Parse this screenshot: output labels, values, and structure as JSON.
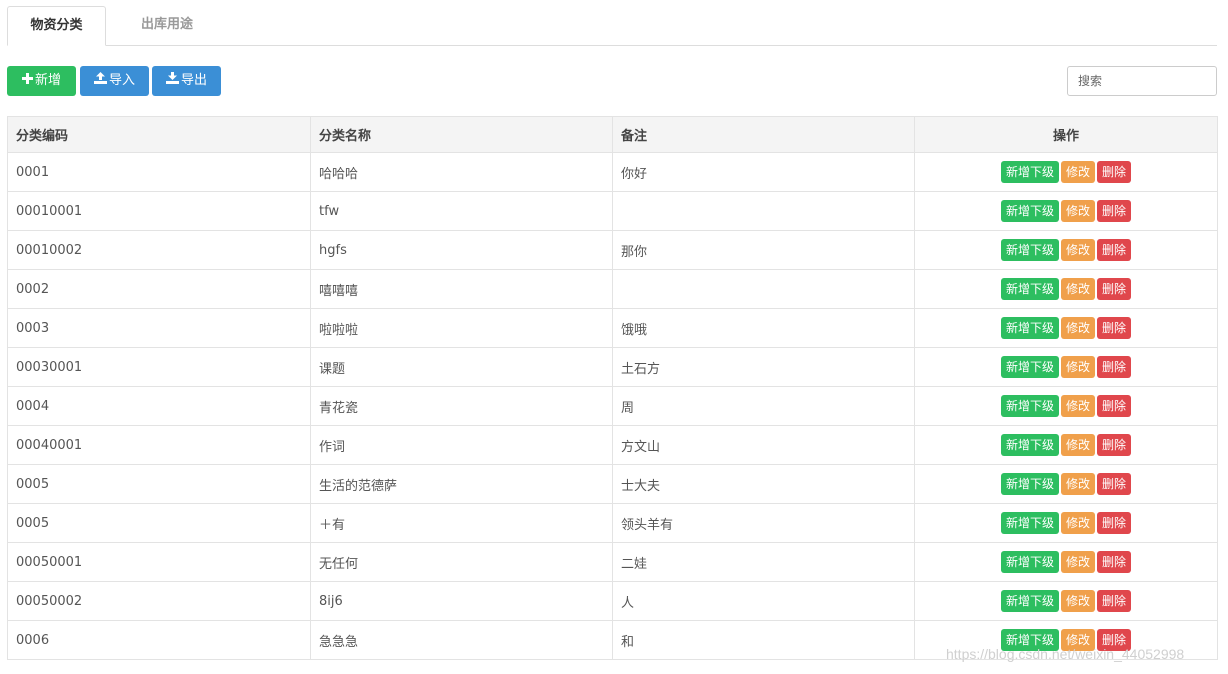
{
  "tabs": [
    {
      "label": "物资分类",
      "active": true
    },
    {
      "label": "出库用途",
      "active": false
    }
  ],
  "toolbar": {
    "add_label": "新增",
    "import_label": "导入",
    "export_label": "导出",
    "add_icon": "plus-icon",
    "import_icon": "upload-icon",
    "export_icon": "download-icon"
  },
  "search": {
    "placeholder": "搜索",
    "value": ""
  },
  "table": {
    "headers": {
      "code": "分类编码",
      "name": "分类名称",
      "remark": "备注",
      "ops": "操作"
    },
    "actions": {
      "add_child": "新增下级",
      "edit": "修改",
      "delete": "删除"
    },
    "rows": [
      {
        "code": "0001",
        "name": "哈哈哈",
        "remark": "你好"
      },
      {
        "code": "00010001",
        "name": "tfw",
        "remark": ""
      },
      {
        "code": "00010002",
        "name": "hgfs",
        "remark": "那你"
      },
      {
        "code": "0002",
        "name": "嘻嘻嘻",
        "remark": ""
      },
      {
        "code": "0003",
        "name": "啦啦啦",
        "remark": "饿哦"
      },
      {
        "code": "00030001",
        "name": "课题",
        "remark": "土石方"
      },
      {
        "code": "0004",
        "name": "青花瓷",
        "remark": "周"
      },
      {
        "code": "00040001",
        "name": "作词",
        "remark": "方文山"
      },
      {
        "code": "0005",
        "name": "生活的范德萨",
        "remark": "士大夫"
      },
      {
        "code": "0005",
        "name": "＋有",
        "remark": "领头羊有"
      },
      {
        "code": "00050001",
        "name": "无任何",
        "remark": "二娃"
      },
      {
        "code": "00050002",
        "name": "8ij6",
        "remark": "人"
      },
      {
        "code": "0006",
        "name": "急急急",
        "remark": "和"
      }
    ]
  },
  "colors": {
    "success": "#2dbe60",
    "primary": "#3b8fd6",
    "warning": "#f0a04b",
    "danger": "#e0474c"
  },
  "watermark": "https://blog.csdn.net/weixin_44052998"
}
